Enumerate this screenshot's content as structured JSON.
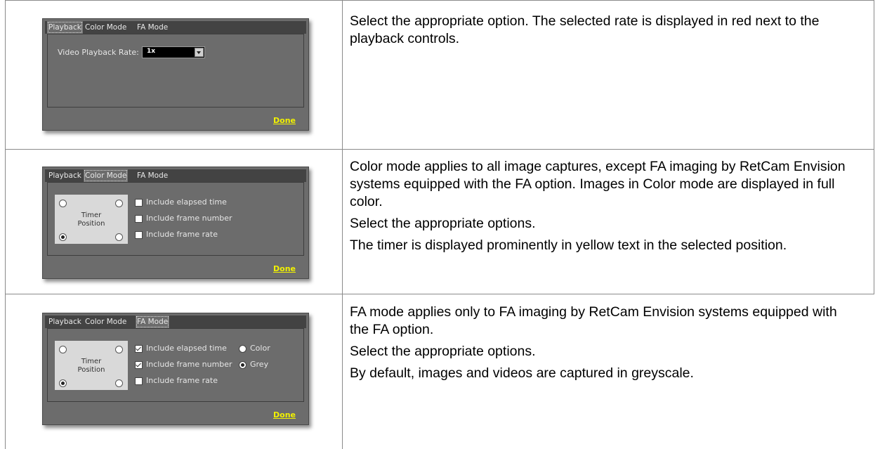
{
  "rows": [
    {
      "dialog": {
        "tabs": [
          "Playback",
          "Color Mode",
          "FA Mode"
        ],
        "active_tab": "Playback",
        "rate_label": "Video Playback Rate:",
        "rate_value": "1x",
        "done": "Done"
      },
      "description": [
        "Select the appropriate option. The selected rate is displayed in red next to the playback controls."
      ]
    },
    {
      "dialog": {
        "tabs": [
          "Playback",
          "Color Mode",
          "FA Mode"
        ],
        "active_tab": "Color Mode",
        "timer_position_label": "Timer Position",
        "timer_position_selected": "bottom-left",
        "checkboxes": [
          {
            "label": "Include elapsed time",
            "checked": false
          },
          {
            "label": "Include frame number",
            "checked": false
          },
          {
            "label": "Include frame rate",
            "checked": false
          }
        ],
        "done": "Done"
      },
      "description": [
        "Color mode applies to all image captures, except FA imaging by RetCam Envision systems equipped with the FA option. Images in Color mode are displayed in full color.",
        "Select the appropriate options.",
        "The timer is displayed prominently in yellow text in the selected position."
      ]
    },
    {
      "dialog": {
        "tabs": [
          "Playback",
          "Color Mode",
          "FA Mode"
        ],
        "active_tab": "FA Mode",
        "timer_position_label": "Timer Position",
        "timer_position_selected": "bottom-left",
        "checkboxes": [
          {
            "label": "Include elapsed time",
            "checked": true
          },
          {
            "label": "Include frame number",
            "checked": true
          },
          {
            "label": "Include frame rate",
            "checked": false
          }
        ],
        "color_options": [
          {
            "label": "Color",
            "selected": false
          },
          {
            "label": "Grey",
            "selected": true
          }
        ],
        "done": "Done"
      },
      "description": [
        "FA mode applies only to FA imaging by RetCam Envision systems equipped with the FA option.",
        "Select the appropriate options.",
        "By default, images and videos are captured in greyscale."
      ]
    }
  ]
}
